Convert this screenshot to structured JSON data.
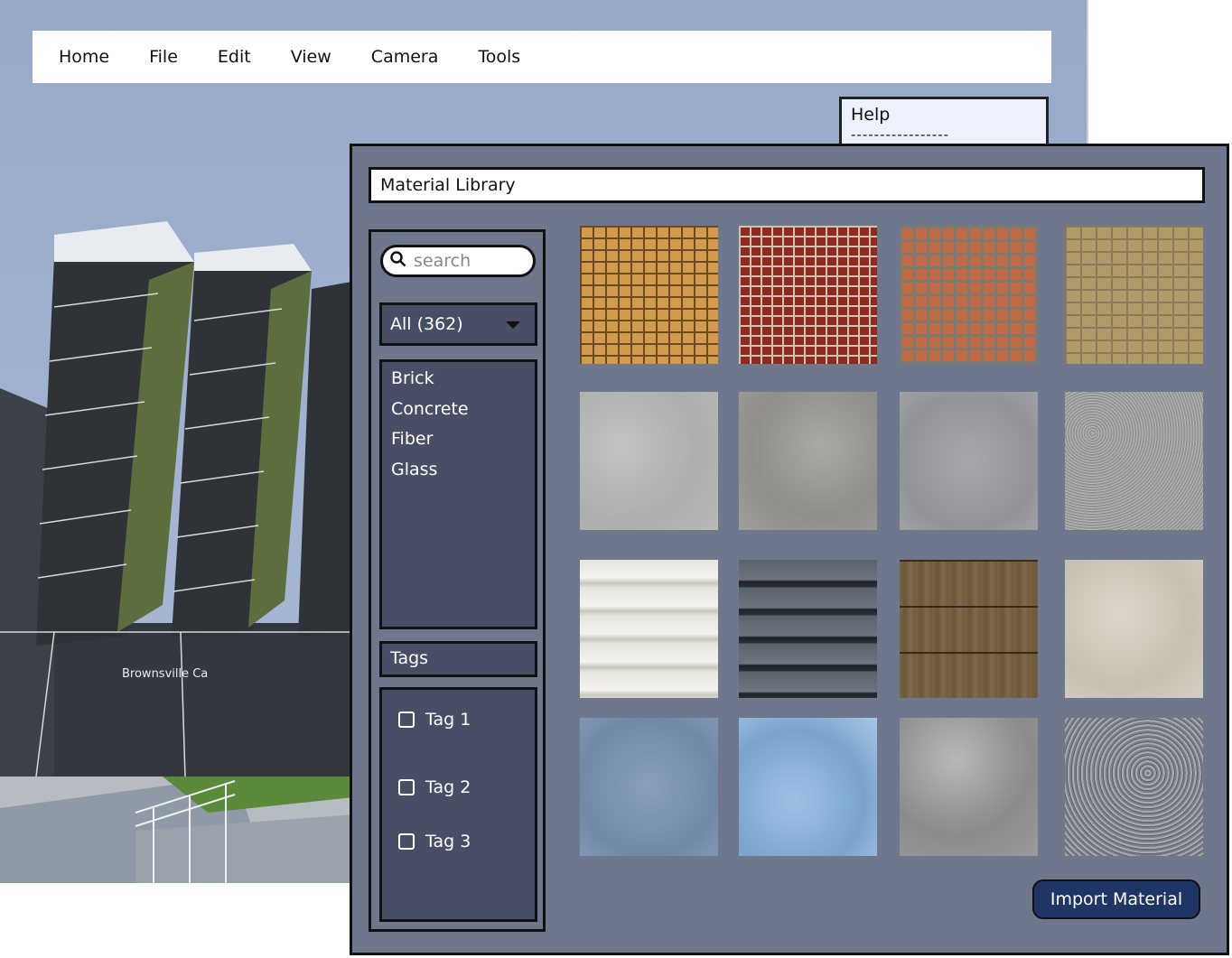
{
  "menu": {
    "items": [
      "Home",
      "File",
      "Edit",
      "View",
      "Camera",
      "Tools"
    ]
  },
  "help_panel": {
    "title": "Help",
    "separator": "-----------------"
  },
  "material_library": {
    "title": "Material Library",
    "search": {
      "placeholder": "search",
      "value": ""
    },
    "filter": {
      "selected": "All (362)"
    },
    "categories": [
      "Brick",
      "Concrete",
      "Fiber",
      "Glass"
    ],
    "tags_header": "Tags",
    "tags": [
      {
        "label": "Tag 1",
        "checked": false
      },
      {
        "label": "Tag 2",
        "checked": false
      },
      {
        "label": "Tag 3",
        "checked": false
      }
    ],
    "swatches": [
      "brick-tan",
      "brick-red",
      "brick-orange",
      "brick-yellow",
      "concrete-light",
      "concrete-speckled",
      "concrete-smooth",
      "concrete-granular",
      "fiber-white-siding",
      "fiber-dark-siding",
      "wood-planks",
      "stone-beige",
      "ice-blue",
      "ice-light-blue",
      "marble-gray",
      "granite-gray"
    ],
    "import_button": "Import Material"
  },
  "scene_sign_text": "Brownsville Ca",
  "colors": {
    "dialog_bg": "#6e778c",
    "panel_bg": "#474e66",
    "button_bg": "#1f3566",
    "app_bg": "#9fb0cf"
  }
}
